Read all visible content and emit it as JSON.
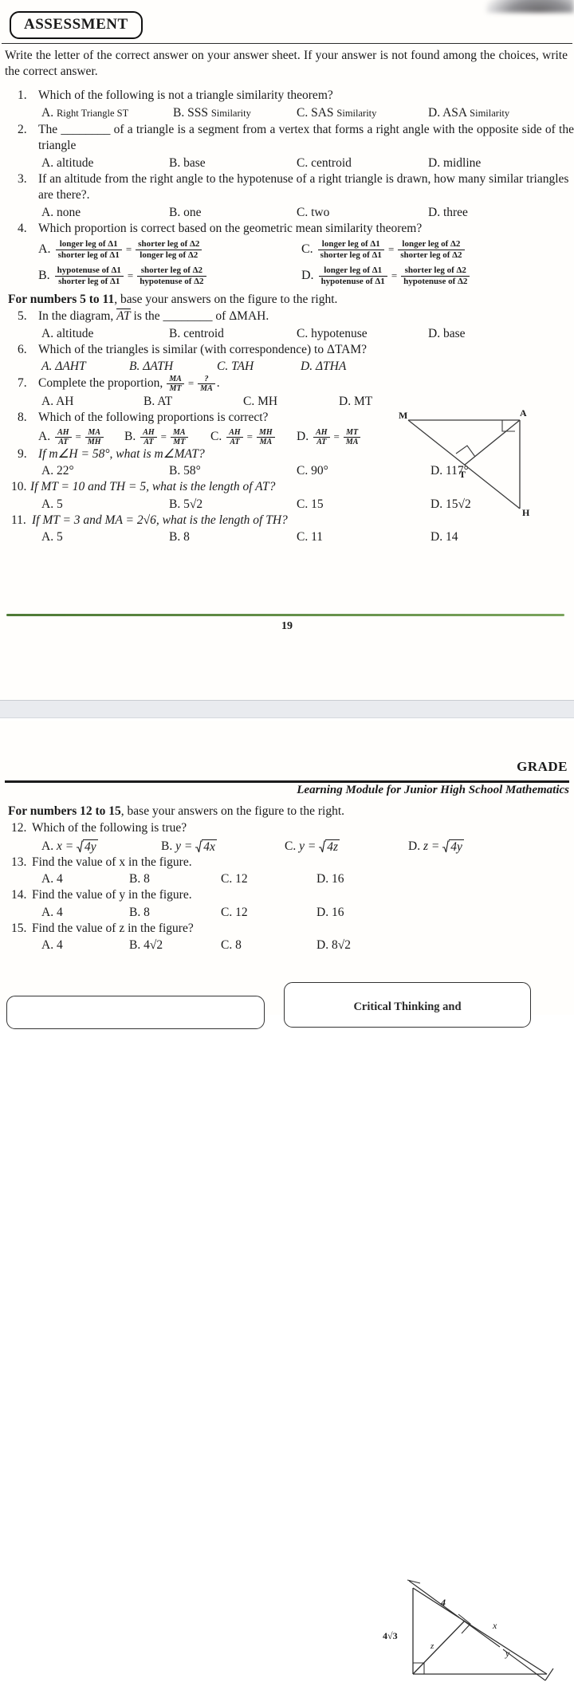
{
  "page1": {
    "badge": "ASSESSMENT",
    "instructions": "Write the letter of the correct answer on your answer sheet. If your answer is not found among the choices, write the correct answer.",
    "questions": [
      {
        "num": "1.",
        "text": "Which of the following is not a triangle similarity theorem?",
        "choices": [
          "A. Right Triangle ST",
          "B. SSS Similarity",
          "C. SAS Similarity",
          "D. ASA Similarity"
        ],
        "choice_letters": [
          "A.",
          "B.",
          "C.",
          "D."
        ],
        "choice_main": [
          "Right Triangle ST",
          "SSS",
          "SAS",
          "ASA"
        ],
        "choice_sub": [
          "",
          "Similarity",
          "Similarity",
          "Similarity"
        ]
      },
      {
        "num": "2.",
        "text": "The ________ of a triangle is a segment from a vertex that forms a right angle with the opposite side of the triangle",
        "choices": [
          "A. altitude",
          "B. base",
          "C. centroid",
          "D. midline"
        ]
      },
      {
        "num": "3.",
        "text": "If an altitude from the right angle to the hypotenuse of a right triangle is drawn, how many similar triangles are there?.",
        "choices": [
          "A. none",
          "B. one",
          "C. two",
          "D. three"
        ]
      },
      {
        "num": "4.",
        "text": "Which proportion is correct based on the geometric mean similarity theorem?",
        "fraction_choices": [
          {
            "letter": "A.",
            "n1": "longer leg of Δ1",
            "d1": "shorter leg of Δ1",
            "n2": "shorter leg of Δ2",
            "d2": "longer leg of Δ2"
          },
          {
            "letter": "C.",
            "n1": "longer leg of Δ1",
            "d1": "shorter leg of Δ1",
            "n2": "longer leg of Δ2",
            "d2": "shorter leg of Δ2"
          },
          {
            "letter": "B.",
            "n1": "hypotenuse of Δ1",
            "d1": "shorter leg of Δ1",
            "n2": "shorter leg of Δ2",
            "d2": "hypotenuse of Δ2"
          },
          {
            "letter": "D.",
            "n1": "longer leg of Δ1",
            "d1": "hypotenuse of Δ1",
            "n2": "shorter leg of Δ2",
            "d2": "hypotenuse of Δ2"
          }
        ]
      },
      {
        "num": "5.",
        "text_pre": "In the diagram, ",
        "text_seg": "AT",
        "text_post": " is the ________ of ΔMAH.",
        "choices": [
          "A. altitude",
          "B. centroid",
          "C. hypotenuse",
          "D. base"
        ]
      },
      {
        "num": "6.",
        "text": "Which of the triangles is similar (with correspondence) to ΔTAM?",
        "choices": [
          "A. ΔAHT",
          "B. ΔATH",
          "C. TAH",
          "D. ΔTHA"
        ]
      },
      {
        "num": "7.",
        "text": "Complete the proportion,",
        "proportion": {
          "n1": "MA",
          "d1": "MT",
          "n2": "?",
          "d2": "MA"
        },
        "choices": [
          "A. AH",
          "B. AT",
          "C. MH",
          "D. MT"
        ]
      },
      {
        "num": "8.",
        "text": "Which of the following proportions is correct?",
        "fraction_choices": [
          {
            "letter": "A.",
            "n1": "AH",
            "d1": "AT",
            "n2": "MA",
            "d2": "MH"
          },
          {
            "letter": "B.",
            "n1": "AH",
            "d1": "AT",
            "n2": "MA",
            "d2": "MT"
          },
          {
            "letter": "C.",
            "n1": "AH",
            "d1": "AT",
            "n2": "MH",
            "d2": "MA"
          },
          {
            "letter": "D.",
            "n1": "AH",
            "d1": "AT",
            "n2": "MT",
            "d2": "MA"
          }
        ]
      },
      {
        "num": "9.",
        "text": "If m∠H = 58°, what is m∠MAT?",
        "choices": [
          "A. 22°",
          "B. 58°",
          "C. 90°",
          "D. 117°"
        ]
      },
      {
        "num": "10.",
        "text": "If MT = 10 and TH = 5, what is the length of AT?",
        "choices": [
          "A. 5",
          "B. 5√2",
          "C. 15",
          "D. 15√2"
        ]
      },
      {
        "num": "11.",
        "text": "If MT = 3 and MA = 2√6, what is the length of TH?",
        "choices": [
          "A. 5",
          "B. 8",
          "C. 11",
          "D. 14"
        ]
      }
    ],
    "directions_5_11": {
      "bold": "For numbers 5 to 11",
      "rest": ", base your answers on the figure to the right."
    },
    "figure1": {
      "labels": [
        "M",
        "A",
        "T",
        "H"
      ],
      "name": "triangle-mah-altitude"
    },
    "page_number": "19",
    "divider_color": "#4e7a36"
  },
  "page2": {
    "grade_label": "GRADE",
    "module_title": "Learning Module for Junior High School Mathematics",
    "directions_12_15": {
      "bold": "For numbers 12 to 15",
      "rest": ", base your answers on the figure to the right."
    },
    "questions": [
      {
        "num": "12.",
        "text": "Which of the following is true?",
        "radical_choices": [
          {
            "letter": "A.",
            "lhs": "x =",
            "rad": "4y"
          },
          {
            "letter": "B.",
            "lhs": "y =",
            "rad": "4x"
          },
          {
            "letter": "C.",
            "lhs": "y =",
            "rad": "4z"
          },
          {
            "letter": "D.",
            "lhs": "z =",
            "rad": "4y"
          }
        ]
      },
      {
        "num": "13.",
        "text": "Find the value of x in the figure.",
        "choices": [
          "A. 4",
          "B. 8",
          "C. 12",
          "D. 16"
        ]
      },
      {
        "num": "14.",
        "text": "Find the value of y in the figure.",
        "choices": [
          "A. 4",
          "B. 8",
          "C. 12",
          "D. 16"
        ]
      },
      {
        "num": "15.",
        "text": "Find the value of z in the figure?",
        "choices": [
          "A. 4",
          "B. 4√2",
          "C. 8",
          "D. 8√2"
        ]
      }
    ],
    "figure2": {
      "labels": [
        "4√3",
        "4",
        "x",
        "y",
        "z"
      ],
      "name": "right-triangle-altitude-figure"
    },
    "bottom_boxes": [
      {
        "text": ""
      },
      {
        "text": "Critical Thinking  and"
      }
    ]
  }
}
